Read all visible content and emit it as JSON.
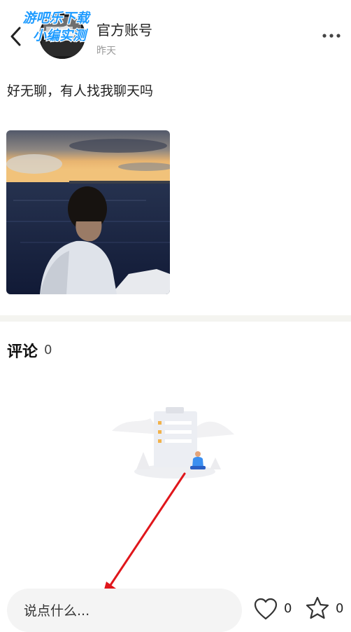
{
  "header": {
    "author_name": "官方账号",
    "post_time": "昨天",
    "back_icon": "chevron-left-icon",
    "more_icon": "more-horizontal-icon"
  },
  "watermark": {
    "line1": "游吧乐下载",
    "line2": "小编实测"
  },
  "post": {
    "text": "好无聊，有人找我聊天吗",
    "image_desc": "person-at-sea-sunset-photo"
  },
  "comments": {
    "title": "评论",
    "count": "0"
  },
  "bottom_bar": {
    "input_placeholder": "说点什么...",
    "like_count": "0",
    "favorite_count": "0"
  },
  "colors": {
    "annotation_arrow": "#e0161b",
    "divider": "#f4f4f0",
    "input_bg": "#f4f4f4",
    "watermark_fill": "#1e9bff"
  }
}
